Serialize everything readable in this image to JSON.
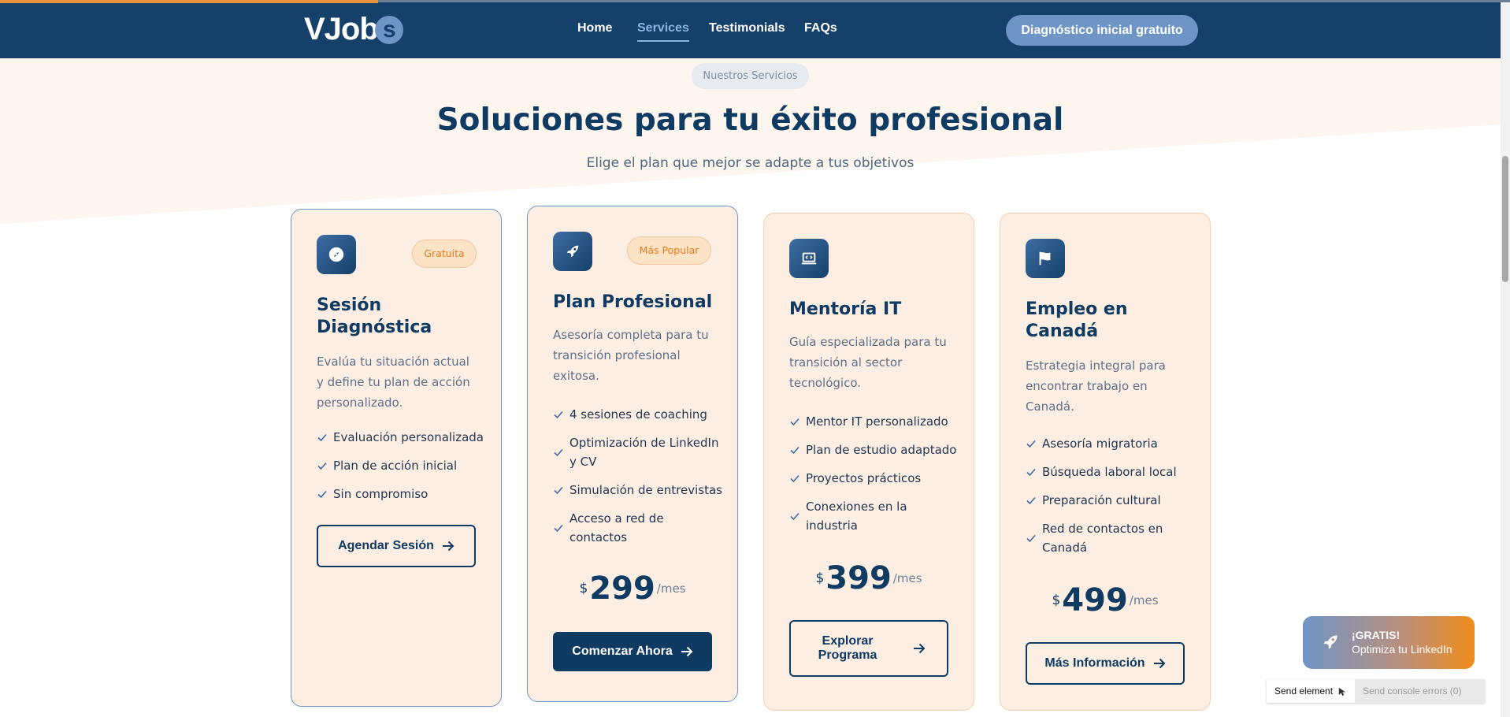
{
  "header": {
    "logo": "VJob",
    "logo_s": "s",
    "nav": [
      {
        "label": "Home"
      },
      {
        "label": "Services"
      },
      {
        "label": "Testimonials"
      },
      {
        "label": "FAQs"
      }
    ],
    "active_nav": "Services",
    "cta": "Diagnóstico inicial gratuito"
  },
  "hero": {
    "pill": "Nuestros Servicios",
    "title": "Soluciones para tu éxito profesional",
    "subtitle": "Elige el plan que mejor se adapte a tus objetivos"
  },
  "cards": [
    {
      "icon": "compass-icon",
      "badge": "Gratuita",
      "title": "Sesión Diagnóstica",
      "desc": "Evalúa tu situación actual y define tu plan de acción personalizado.",
      "features": [
        "Evaluación personalizada",
        "Plan de acción inicial",
        "Sin compromiso"
      ],
      "button": "Agendar Sesión"
    },
    {
      "icon": "rocket-icon",
      "badge": "Más Popular",
      "title": "Plan Profesional",
      "desc": "Asesoría completa para tu transición profesional exitosa.",
      "features": [
        "4 sesiones de coaching",
        "Optimización de LinkedIn y CV",
        "Simulación de entrevistas",
        "Acceso a red de contactos"
      ],
      "price": {
        "currency": "$",
        "amount": "299",
        "period": "/mes"
      },
      "button": "Comenzar Ahora"
    },
    {
      "icon": "laptop-code-icon",
      "title": "Mentoría IT",
      "desc": "Guía especializada para tu transición al sector tecnológico.",
      "features": [
        "Mentor IT personalizado",
        "Plan de estudio adaptado",
        "Proyectos prácticos",
        "Conexiones en la industria"
      ],
      "price": {
        "currency": "$",
        "amount": "399",
        "period": "/mes"
      },
      "button": "Explorar Programa"
    },
    {
      "icon": "flag-icon",
      "title": "Empleo en Canadá",
      "desc": "Estrategia integral para encontrar trabajo en Canadá.",
      "features": [
        "Asesoría migratoria",
        "Búsqueda laboral local",
        "Preparación cultural",
        "Red de contactos en Canadá"
      ],
      "price": {
        "currency": "$",
        "amount": "499",
        "period": "/mes"
      },
      "button": "Más Información"
    }
  ],
  "floating_cta": {
    "line1": "¡GRATIS!",
    "line2": "Optimiza tu LinkedIn"
  },
  "dev_bar": {
    "send_element": "Send element",
    "send_errors": "Send console errors (0)"
  },
  "colors": {
    "navy": "#15406a",
    "accent_orange": "#f08c1a",
    "card_bg": "#fdeee3",
    "blue_light": "#6f95c6"
  }
}
